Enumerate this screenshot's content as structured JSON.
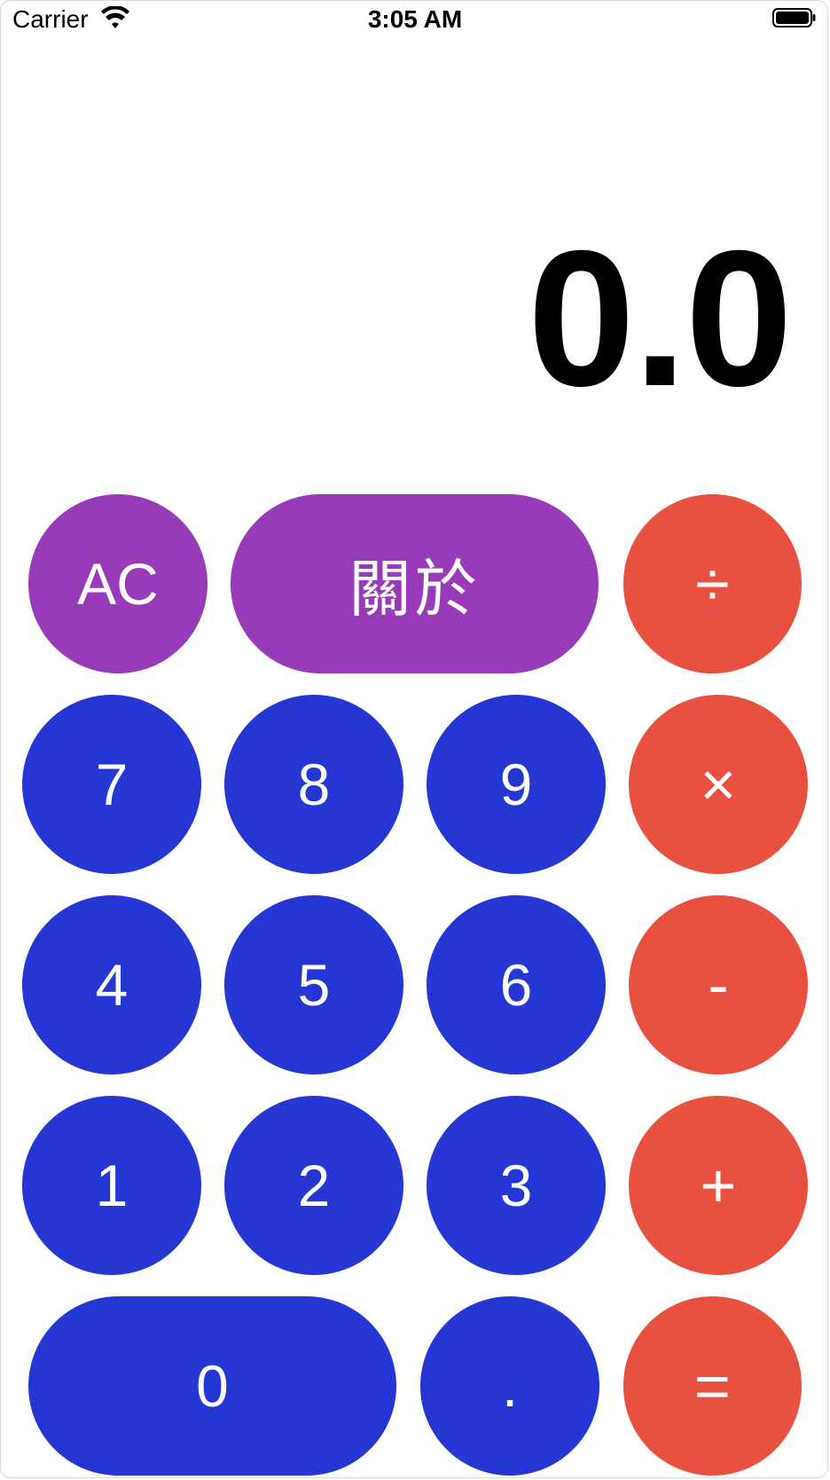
{
  "status_bar": {
    "carrier": "Carrier",
    "time": "3:05 AM",
    "wifi_icon": "wifi-icon",
    "battery_icon": "battery-icon"
  },
  "display": {
    "value": "0.0"
  },
  "colors": {
    "purple": "#973bb8",
    "blue": "#2437d3",
    "red": "#e8503f",
    "background": "#ffffff"
  },
  "keys": {
    "ac": "AC",
    "about": "關於",
    "divide": "÷",
    "seven": "7",
    "eight": "8",
    "nine": "9",
    "multiply": "×",
    "four": "4",
    "five": "5",
    "six": "6",
    "minus": "-",
    "one": "1",
    "two": "2",
    "three": "3",
    "plus": "+",
    "zero": "0",
    "decimal": ".",
    "equals": "="
  }
}
